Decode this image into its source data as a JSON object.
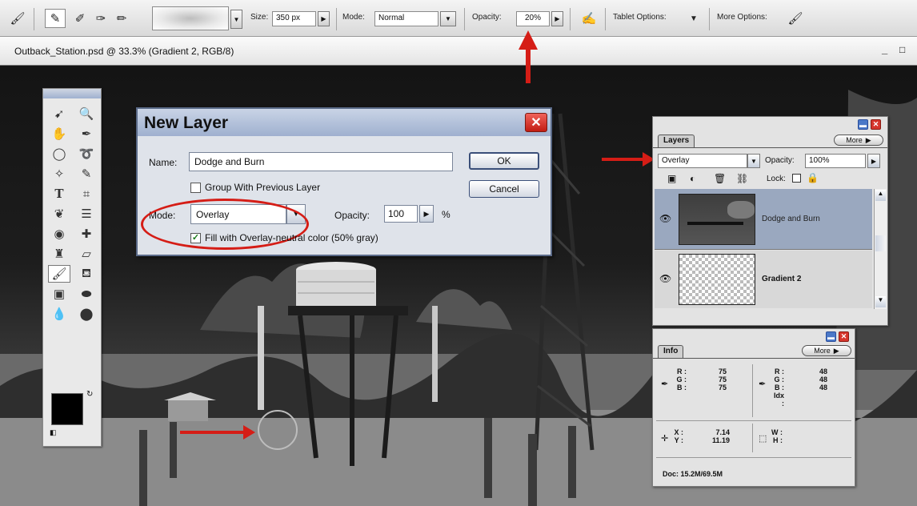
{
  "options_bar": {
    "size_label": "Size:",
    "size_value": "350 px",
    "mode_label": "Mode:",
    "mode_value": "Normal",
    "opacity_label": "Opacity:",
    "opacity_value": "20%",
    "tablet_label": "Tablet Options:",
    "more_label": "More Options:"
  },
  "document": {
    "title": "Outback_Station.psd @ 33.3% (Gradient 2, RGB/8)",
    "min_btn": "_",
    "max_btn": "□"
  },
  "dialog": {
    "title": "New Layer",
    "close_glyph": "✕",
    "name_label": "Name:",
    "name_value": "Dodge and Burn",
    "group_label": "Group With Previous Layer",
    "mode_label": "Mode:",
    "mode_value": "Overlay",
    "opacity_label": "Opacity:",
    "opacity_value": "100",
    "opacity_unit": "%",
    "fill_label": "Fill with Overlay-neutral color (50% gray)",
    "fill_checked": true,
    "ok_label": "OK",
    "cancel_label": "Cancel"
  },
  "layers_panel": {
    "tab_label": "Layers",
    "more_label": "More",
    "blend_mode": "Overlay",
    "opacity_label": "Opacity:",
    "opacity_value": "100%",
    "lock_label": "Lock:",
    "layers": [
      {
        "name": "Dodge and Burn",
        "selected": true
      },
      {
        "name": "Gradient 2",
        "selected": false
      }
    ]
  },
  "info_panel": {
    "tab_label": "Info",
    "more_label": "More",
    "r_label": "R :",
    "g_label": "G :",
    "b_label": "B :",
    "left_rgb": [
      "75",
      "75",
      "75"
    ],
    "right_rgb": [
      "48",
      "48",
      "48"
    ],
    "idx_label": "Idx :",
    "x_label": "X :",
    "y_label": "Y :",
    "x_value": "7.14",
    "y_value": "11.19",
    "w_label": "W :",
    "h_label": "H :",
    "doc_text": "Doc: 15.2M/69.5M"
  },
  "colors": {
    "annotation_red": "#d51d16",
    "dialog_title": "#9fb0cf",
    "selected_layer": "#9aa8bf"
  }
}
